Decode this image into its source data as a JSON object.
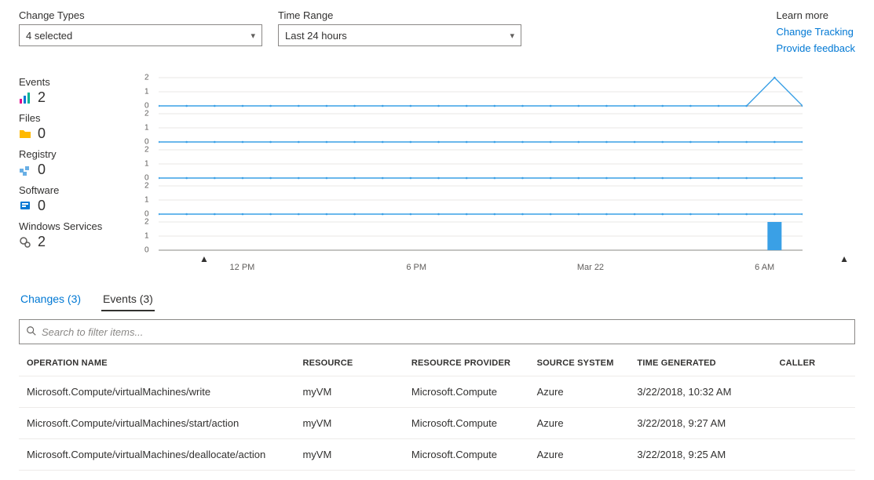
{
  "filters": {
    "change_types": {
      "label": "Change Types",
      "value": "4 selected"
    },
    "time_range": {
      "label": "Time Range",
      "value": "Last 24 hours"
    }
  },
  "learn": {
    "label": "Learn more",
    "link_tracking": "Change Tracking",
    "link_feedback": "Provide feedback"
  },
  "summary": {
    "events": {
      "label": "Events",
      "count": "2"
    },
    "files": {
      "label": "Files",
      "count": "0"
    },
    "registry": {
      "label": "Registry",
      "count": "0"
    },
    "software": {
      "label": "Software",
      "count": "0"
    },
    "services": {
      "label": "Windows Services",
      "count": "2"
    }
  },
  "chart_data": [
    {
      "name": "Events",
      "type": "line",
      "yticks": [
        "2",
        "1",
        "0"
      ],
      "x": [
        0,
        1,
        2,
        3,
        4,
        5,
        6,
        7,
        8,
        9,
        10,
        11,
        12,
        13,
        14,
        15,
        16,
        17,
        18,
        19,
        20,
        21,
        22,
        23
      ],
      "values": [
        0,
        0,
        0,
        0,
        0,
        0,
        0,
        0,
        0,
        0,
        0,
        0,
        0,
        0,
        0,
        0,
        0,
        0,
        0,
        0,
        0,
        0,
        2,
        0
      ]
    },
    {
      "name": "Files",
      "type": "line",
      "yticks": [
        "2",
        "1",
        "0"
      ],
      "x": [
        0,
        1,
        2,
        3,
        4,
        5,
        6,
        7,
        8,
        9,
        10,
        11,
        12,
        13,
        14,
        15,
        16,
        17,
        18,
        19,
        20,
        21,
        22,
        23
      ],
      "values": [
        0,
        0,
        0,
        0,
        0,
        0,
        0,
        0,
        0,
        0,
        0,
        0,
        0,
        0,
        0,
        0,
        0,
        0,
        0,
        0,
        0,
        0,
        0,
        0
      ]
    },
    {
      "name": "Registry",
      "type": "line",
      "yticks": [
        "2",
        "1",
        "0"
      ],
      "x": [
        0,
        1,
        2,
        3,
        4,
        5,
        6,
        7,
        8,
        9,
        10,
        11,
        12,
        13,
        14,
        15,
        16,
        17,
        18,
        19,
        20,
        21,
        22,
        23
      ],
      "values": [
        0,
        0,
        0,
        0,
        0,
        0,
        0,
        0,
        0,
        0,
        0,
        0,
        0,
        0,
        0,
        0,
        0,
        0,
        0,
        0,
        0,
        0,
        0,
        0
      ]
    },
    {
      "name": "Software",
      "type": "line",
      "yticks": [
        "2",
        "1",
        "0"
      ],
      "x": [
        0,
        1,
        2,
        3,
        4,
        5,
        6,
        7,
        8,
        9,
        10,
        11,
        12,
        13,
        14,
        15,
        16,
        17,
        18,
        19,
        20,
        21,
        22,
        23
      ],
      "values": [
        0,
        0,
        0,
        0,
        0,
        0,
        0,
        0,
        0,
        0,
        0,
        0,
        0,
        0,
        0,
        0,
        0,
        0,
        0,
        0,
        0,
        0,
        0,
        0
      ]
    },
    {
      "name": "Windows Services",
      "type": "bar",
      "yticks": [
        "2",
        "1",
        "0"
      ],
      "x": [
        0,
        1,
        2,
        3,
        4,
        5,
        6,
        7,
        8,
        9,
        10,
        11,
        12,
        13,
        14,
        15,
        16,
        17,
        18,
        19,
        20,
        21,
        22,
        23
      ],
      "values": [
        0,
        0,
        0,
        0,
        0,
        0,
        0,
        0,
        0,
        0,
        0,
        0,
        0,
        0,
        0,
        0,
        0,
        0,
        0,
        0,
        0,
        0,
        2,
        0
      ]
    }
  ],
  "xaxis": {
    "labels": [
      "12 PM",
      "6 PM",
      "Mar 22",
      "6 AM"
    ]
  },
  "tabs": {
    "changes": "Changes (3)",
    "events": "Events (3)"
  },
  "search": {
    "placeholder": "Search to filter items..."
  },
  "table": {
    "headers": {
      "op": "OPERATION NAME",
      "res": "RESOURCE",
      "prov": "RESOURCE PROVIDER",
      "src": "SOURCE SYSTEM",
      "time": "TIME GENERATED",
      "caller": "CALLER"
    },
    "rows": [
      {
        "op": "Microsoft.Compute/virtualMachines/write",
        "res": "myVM",
        "prov": "Microsoft.Compute",
        "src": "Azure",
        "time": "3/22/2018, 10:32 AM",
        "caller": ""
      },
      {
        "op": "Microsoft.Compute/virtualMachines/start/action",
        "res": "myVM",
        "prov": "Microsoft.Compute",
        "src": "Azure",
        "time": "3/22/2018, 9:27 AM",
        "caller": ""
      },
      {
        "op": "Microsoft.Compute/virtualMachines/deallocate/action",
        "res": "myVM",
        "prov": "Microsoft.Compute",
        "src": "Azure",
        "time": "3/22/2018, 9:25 AM",
        "caller": ""
      }
    ]
  },
  "colors": {
    "accent": "#0078d4",
    "chart_line": "#3aa0e6",
    "chart_bar": "#3aa0e6"
  }
}
